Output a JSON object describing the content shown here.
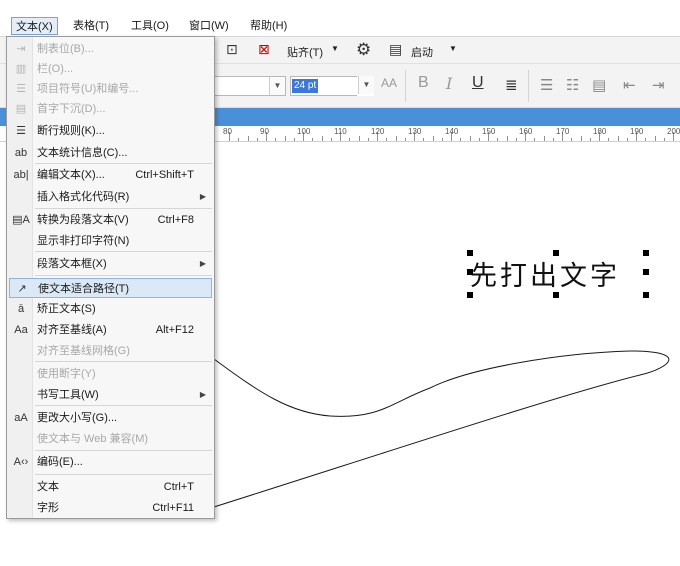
{
  "menubar": {
    "items": [
      {
        "label": "文本(X)"
      },
      {
        "label": "表格(T)"
      },
      {
        "label": "工具(O)"
      },
      {
        "label": "窗口(W)"
      },
      {
        "label": "帮助(H)"
      }
    ]
  },
  "toolbar": {
    "snap_label": "贴齐(T)",
    "launch_label": "启动",
    "font_size": "24 pt",
    "bold": "B",
    "italic": "I",
    "underline": "U",
    "aa_label": "AA"
  },
  "ruler": {
    "numbers": [
      "80",
      "90",
      "100",
      "110",
      "120",
      "130",
      "140",
      "150",
      "160",
      "170",
      "180",
      "190",
      "200"
    ]
  },
  "canvas": {
    "path_text": "先打出文字"
  },
  "menu": {
    "items": [
      {
        "label": "制表位(B)...",
        "icon": "tab-stops-icon",
        "enabled": false
      },
      {
        "label": "栏(O)...",
        "icon": "columns-icon",
        "enabled": false
      },
      {
        "label": "项目符号(U)和编号...",
        "icon": "bullets-icon",
        "enabled": false
      },
      {
        "label": "首字下沉(D)...",
        "icon": "drop-cap-icon",
        "enabled": false
      },
      {
        "label": "断行规则(K)...",
        "icon": "line-break-icon",
        "enabled": true
      },
      {
        "label": "文本统计信息(C)...",
        "icon": "text-statistics-icon",
        "enabled": true
      },
      {
        "label": "编辑文本(X)...",
        "shortcut": "Ctrl+Shift+T",
        "icon": "edit-text-icon",
        "enabled": true
      },
      {
        "label": "插入格式化代码(R)",
        "icon": "",
        "enabled": true,
        "submenu": true
      },
      {
        "label": "转换为段落文本(V)",
        "shortcut": "Ctrl+F8",
        "icon": "convert-paragraph-icon",
        "enabled": true
      },
      {
        "label": "显示非打印字符(N)",
        "icon": "",
        "enabled": true
      },
      {
        "label": "段落文本框(X)",
        "icon": "",
        "enabled": true,
        "submenu": true
      },
      {
        "label": "使文本适合路径(T)",
        "icon": "fit-text-to-path-icon",
        "enabled": true,
        "highlighted": true
      },
      {
        "label": "矫正文本(S)",
        "icon": "straighten-text-icon",
        "enabled": true
      },
      {
        "label": "对齐至基线(A)",
        "shortcut": "Alt+F12",
        "icon": "align-baseline-icon",
        "enabled": true
      },
      {
        "label": "对齐至基线网格(G)",
        "icon": "",
        "enabled": false
      },
      {
        "label": "使用断字(Y)",
        "icon": "",
        "enabled": false
      },
      {
        "label": "书写工具(W)",
        "icon": "",
        "enabled": true,
        "submenu": true
      },
      {
        "label": "更改大小写(G)...",
        "icon": "change-case-icon",
        "enabled": true
      },
      {
        "label": "使文本与 Web 兼容(M)",
        "icon": "",
        "enabled": false
      },
      {
        "label": "编码(E)...",
        "icon": "encoding-icon",
        "enabled": true
      },
      {
        "label": "文本",
        "shortcut": "Ctrl+T",
        "icon": "",
        "enabled": true
      },
      {
        "label": "字形",
        "shortcut": "Ctrl+F11",
        "icon": "",
        "enabled": true
      }
    ]
  },
  "colors": {
    "menu_highlight": "#dbe8f6",
    "selection_blue": "#3b78d8"
  }
}
